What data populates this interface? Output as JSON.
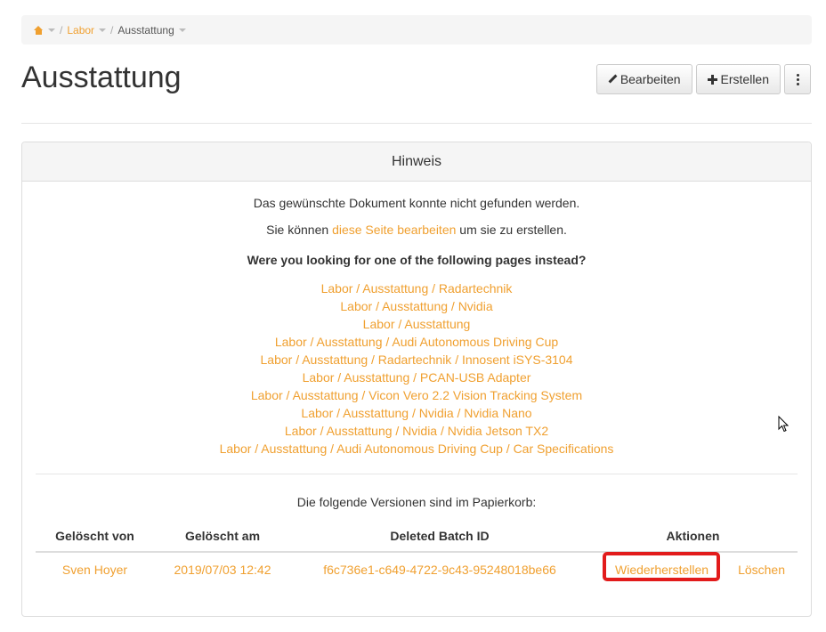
{
  "breadcrumb": {
    "home_icon": "home-icon",
    "items": [
      "Labor",
      "Ausstattung"
    ],
    "separator": "/"
  },
  "page": {
    "title": "Ausstattung"
  },
  "toolbar": {
    "edit_label": "Bearbeiten",
    "create_label": "Erstellen"
  },
  "notice": {
    "heading": "Hinweis",
    "not_found": "Das gewünschte Dokument konnte nicht gefunden werden.",
    "edit_prefix": "Sie können",
    "edit_link": "diese Seite bearbeiten",
    "edit_suffix": "um sie zu erstellen.",
    "question": "Were you looking for one of the following pages instead?",
    "suggestions": [
      "Labor / Ausstattung / Radartechnik",
      "Labor / Ausstattung / Nvidia",
      "Labor / Ausstattung",
      "Labor / Ausstattung / Audi Autonomous Driving Cup",
      "Labor / Ausstattung / Radartechnik / Innosent iSYS-3104",
      "Labor / Ausstattung / PCAN-USB Adapter",
      "Labor / Ausstattung / Vicon Vero 2.2 Vision Tracking System",
      "Labor / Ausstattung / Nvidia / Nvidia Nano",
      "Labor / Ausstattung / Nvidia / Nvidia Jetson TX2",
      "Labor / Ausstattung / Audi Autonomous Driving Cup / Car Specifications"
    ]
  },
  "trash": {
    "info": "Die folgende Versionen sind im Papierkorb:",
    "columns": [
      "Gelöscht von",
      "Gelöscht am",
      "Deleted Batch ID",
      "Aktionen"
    ],
    "rows": [
      {
        "deleted_by": "Sven Hoyer",
        "deleted_at": "2019/07/03 12:42",
        "batch_id": "f6c736e1-c649-4722-9c43-95248018be66",
        "restore": "Wiederherstellen",
        "delete": "Löschen"
      }
    ]
  },
  "colors": {
    "accent": "#f0a030",
    "highlight": "#e21b1b"
  }
}
